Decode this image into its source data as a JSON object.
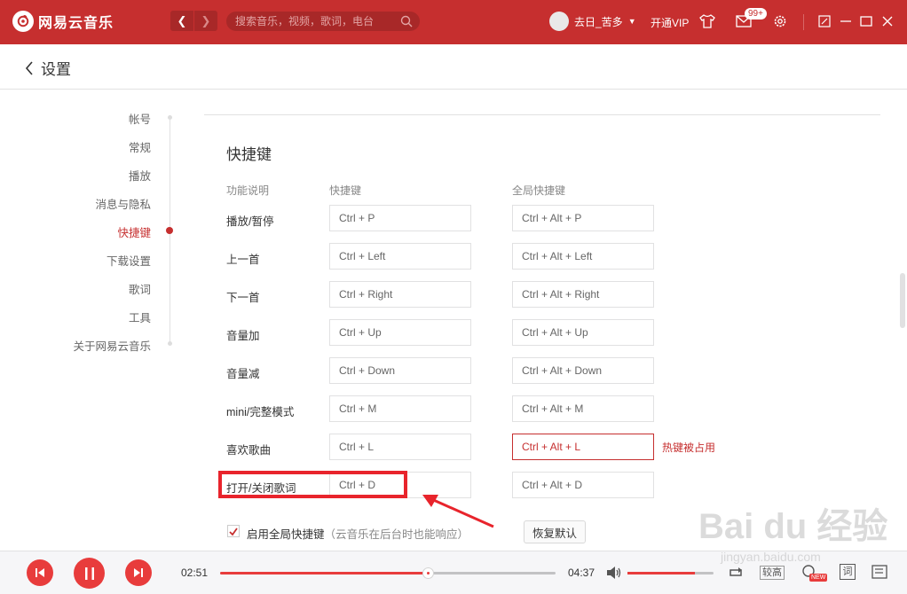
{
  "app": {
    "name": "网易云音乐",
    "brand_color": "#c62f2f",
    "accent_color": "#e83c3c"
  },
  "titlebar": {
    "search_placeholder": "搜索音乐，视频，歌词，电台",
    "user_name": "去日_苦多",
    "vip_label": "开通VIP",
    "message_badge": "99+"
  },
  "header": {
    "title": "设置"
  },
  "sidebar": {
    "items": [
      {
        "label": "帐号",
        "active": false
      },
      {
        "label": "常规",
        "active": false
      },
      {
        "label": "播放",
        "active": false
      },
      {
        "label": "消息与隐私",
        "active": false
      },
      {
        "label": "快捷键",
        "active": true
      },
      {
        "label": "下载设置",
        "active": false
      },
      {
        "label": "歌词",
        "active": false
      },
      {
        "label": "工具",
        "active": false
      },
      {
        "label": "关于网易云音乐",
        "active": false
      }
    ]
  },
  "shortcuts": {
    "title": "快捷键",
    "columns": [
      "功能说明",
      "快捷键",
      "全局快捷键"
    ],
    "rows": [
      {
        "label": "播放/暂停",
        "key": "Ctrl + P",
        "global": "Ctrl + Alt + P"
      },
      {
        "label": "上一首",
        "key": "Ctrl + Left",
        "global": "Ctrl + Alt + Left"
      },
      {
        "label": "下一首",
        "key": "Ctrl + Right",
        "global": "Ctrl + Alt + Right"
      },
      {
        "label": "音量加",
        "key": "Ctrl + Up",
        "global": "Ctrl + Alt + Up"
      },
      {
        "label": "音量减",
        "key": "Ctrl + Down",
        "global": "Ctrl + Alt + Down"
      },
      {
        "label": "mini/完整模式",
        "key": "Ctrl + M",
        "global": "Ctrl + Alt + M"
      },
      {
        "label": "喜欢歌曲",
        "key": "Ctrl + L",
        "global": "Ctrl + Alt + L",
        "conflict": true
      },
      {
        "label": "打开/关闭歌词",
        "key": "Ctrl + D",
        "global": "Ctrl + Alt + D"
      }
    ],
    "conflict_text": "热键被占用",
    "global_enable_label": "启用全局快捷键",
    "global_enable_note": "（云音乐在后台时也能响应）",
    "global_enabled": true,
    "restore_label": "恢复默认"
  },
  "player": {
    "current_time": "02:51",
    "total_time": "04:37",
    "progress": 0.62,
    "volume": 0.78,
    "quality_label": "较高",
    "new_badge": "NEW",
    "lyric_label": "词"
  },
  "watermark": {
    "text": "Bai du 经验",
    "sub": "jingyan.baidu.com"
  }
}
